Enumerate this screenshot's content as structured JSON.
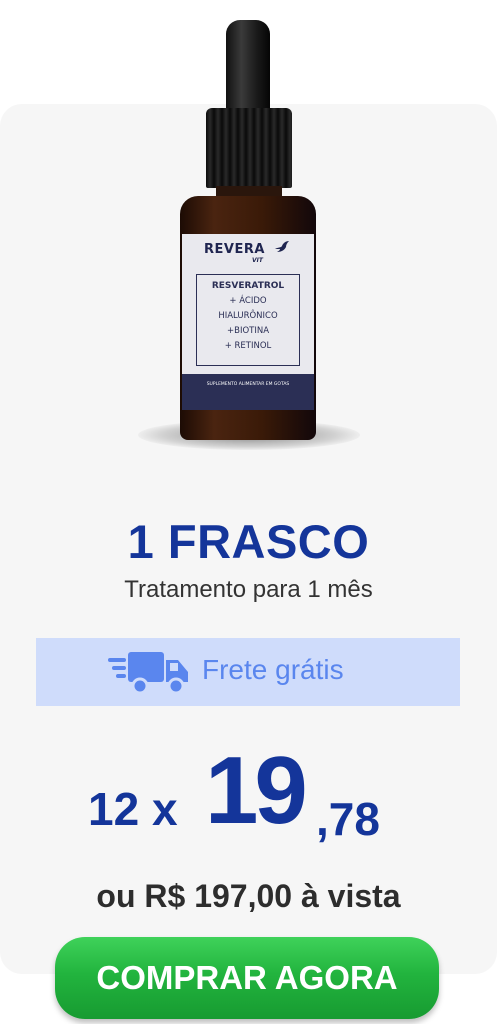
{
  "product": {
    "brand": "REVERA",
    "brand_sub": "VIT",
    "ingredient_main": "RESVERATROL",
    "ingredients": [
      "+ ÁCIDO",
      "HIALURÔNICO",
      "+BIOTINA",
      "+ RETINOL"
    ],
    "band_text": "SUPLEMENTO ALIMENTAR EM GOTAS",
    "colors": {
      "label_band": "#2b2f55",
      "bottle": "#3a1a08",
      "cap": "#1a1a1a"
    }
  },
  "offer": {
    "title": "1 FRASCO",
    "subtitle": "Tratamento para 1 mês",
    "shipping_label": "Frete grátis",
    "shipping_icon": "delivery-truck-icon",
    "installments": "12 x",
    "price_integer": "19",
    "price_decimal": ",78",
    "cash_price": "ou R$ 197,00 à vista"
  },
  "cta": {
    "label": "COMPRAR AGORA",
    "color": "#22b43e"
  },
  "colors": {
    "accent": "#14359a",
    "shipping_bg": "#cfdcfb",
    "shipping_text": "#5a86ee"
  }
}
